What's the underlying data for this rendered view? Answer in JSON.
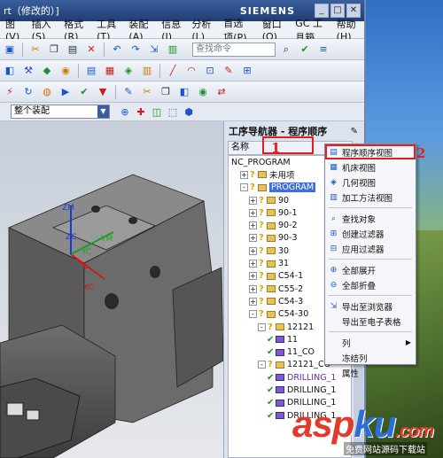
{
  "window": {
    "title": "rt（修改的）]",
    "brand": "SIEMENS",
    "buttons": [
      "_",
      "□",
      "✕"
    ]
  },
  "menu": [
    "图(V)",
    "插入(S)",
    "格式(R)",
    "工具(T)",
    "装配(A)",
    "信息(I)",
    "分析(L)",
    "首选项(P)",
    "窗口(O)",
    "GC 工具箱",
    "帮助(H)"
  ],
  "toolbar": {
    "search_placeholder": "查找命令"
  },
  "filter": {
    "select_value": "整个装配"
  },
  "navigator": {
    "title": "工序导航器 - 程序顺序",
    "column_header": "名称",
    "root": "NC_PROGRAM",
    "rows": [
      {
        "label": "未用项",
        "indent": 1,
        "kind": "folder",
        "exp": "+"
      },
      {
        "label": "PROGRAM",
        "indent": 1,
        "kind": "folder",
        "exp": "-",
        "selected": true
      },
      {
        "label": "90",
        "indent": 2,
        "kind": "folder",
        "exp": "+"
      },
      {
        "label": "90-1",
        "indent": 2,
        "kind": "folder",
        "exp": "+"
      },
      {
        "label": "90-2",
        "indent": 2,
        "kind": "folder",
        "exp": "+"
      },
      {
        "label": "90-3",
        "indent": 2,
        "kind": "folder",
        "exp": "+"
      },
      {
        "label": "30",
        "indent": 2,
        "kind": "folder",
        "exp": "+"
      },
      {
        "label": "31",
        "indent": 2,
        "kind": "folder",
        "exp": "+"
      },
      {
        "label": "C54-1",
        "indent": 2,
        "kind": "folder",
        "exp": "+"
      },
      {
        "label": "C55-2",
        "indent": 2,
        "kind": "folder",
        "exp": "+"
      },
      {
        "label": "C54-3",
        "indent": 2,
        "kind": "folder",
        "exp": "+"
      },
      {
        "label": "C54-30",
        "indent": 2,
        "kind": "folder",
        "exp": "-"
      },
      {
        "label": "12121",
        "indent": 3,
        "kind": "folder",
        "exp": "-"
      },
      {
        "label": "11",
        "indent": 4,
        "kind": "op"
      },
      {
        "label": "11_CO",
        "indent": 4,
        "kind": "op"
      },
      {
        "label": "12121_CO",
        "indent": 3,
        "kind": "folder",
        "exp": "-"
      },
      {
        "label": "DRILLING_1",
        "indent": 4,
        "kind": "op",
        "purple": true
      },
      {
        "label": "DRILLING_1",
        "indent": 4,
        "kind": "op"
      },
      {
        "label": "DRILLING_1",
        "indent": 4,
        "kind": "op"
      },
      {
        "label": "DRILLING_1",
        "indent": 4,
        "kind": "op"
      }
    ]
  },
  "context_menu": {
    "groups": [
      [
        {
          "label": "程序顺序视图",
          "icon": "▤",
          "highlight": true
        },
        {
          "label": "机床视图",
          "icon": "▦"
        },
        {
          "label": "几何视图",
          "icon": "◈"
        },
        {
          "label": "加工方法视图",
          "icon": "▥"
        }
      ],
      [
        {
          "label": "查找对象",
          "icon": "⌕"
        },
        {
          "label": "创建过滤器",
          "icon": "⊞"
        },
        {
          "label": "应用过滤器",
          "icon": "⊟"
        }
      ],
      [
        {
          "label": "全部展开",
          "icon": "⊕"
        },
        {
          "label": "全部折叠",
          "icon": "⊖"
        }
      ],
      [
        {
          "label": "导出至浏览器",
          "icon": "⇲"
        },
        {
          "label": "导出至电子表格",
          "icon": ""
        }
      ],
      [
        {
          "label": "列",
          "icon": "",
          "submenu": true
        },
        {
          "label": "冻结列",
          "icon": ""
        },
        {
          "label": "属性",
          "icon": ""
        }
      ]
    ]
  },
  "annotations": {
    "n1": "1",
    "n2": "2"
  },
  "axes": {
    "zm": "ZM",
    "zc": "ZC",
    "ym": "YM",
    "yc": "YC",
    "xc": "XC"
  },
  "watermark": {
    "main_a": "asp",
    "main_k": "ku",
    "main_b": ".com",
    "sub": "免费网站源码下载站"
  }
}
